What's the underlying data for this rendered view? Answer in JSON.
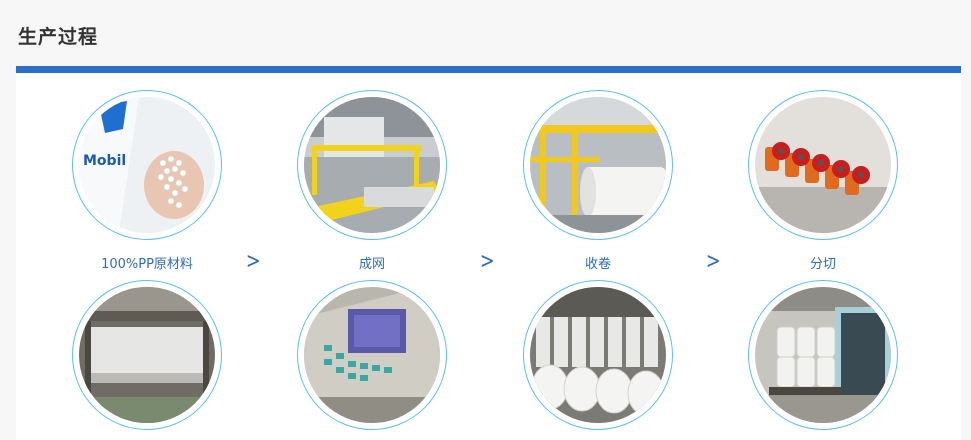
{
  "section": {
    "title": "生产过程"
  },
  "steps": [
    {
      "label": "100%PP原材料",
      "icon": "pp-pellets-image"
    },
    {
      "label": "成网",
      "icon": "web-forming-machine-image"
    },
    {
      "label": "收卷",
      "icon": "winding-roll-image"
    },
    {
      "label": "分切",
      "icon": "slitting-blades-image"
    },
    {
      "label": "",
      "icon": "fabric-production-line-image"
    },
    {
      "label": "",
      "icon": "control-panel-image"
    },
    {
      "label": "",
      "icon": "finished-rolls-image"
    },
    {
      "label": "",
      "icon": "container-loading-image"
    }
  ],
  "arrow_glyph": ">",
  "colors": {
    "accent": "#2b6fc4",
    "ring": "#5bc0e8",
    "label": "#2e6bc0"
  }
}
